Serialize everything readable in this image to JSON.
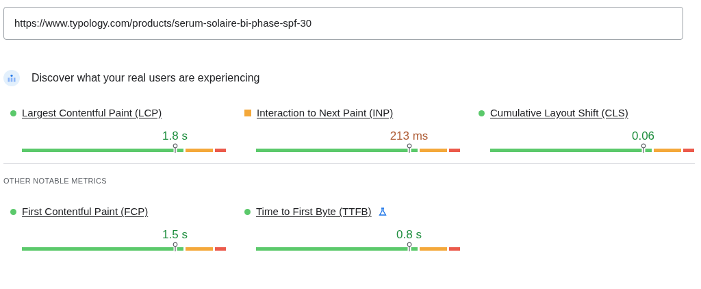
{
  "url_field": {
    "value": "https://www.typology.com/products/serum-solaire-bi-phase-spf-30"
  },
  "field_data": {
    "heading": "Discover what your real users are experiencing",
    "core_metrics": [
      {
        "label": "Largest Contentful Paint (LCP)",
        "kind": "good",
        "value": "1.8 s",
        "experimental": false
      },
      {
        "label": "Interaction to Next Paint (INP)",
        "kind": "average",
        "value": "213 ms",
        "experimental": false
      },
      {
        "label": "Cumulative Layout Shift (CLS)",
        "kind": "good",
        "value": "0.06",
        "experimental": false
      }
    ],
    "other_heading": "OTHER NOTABLE METRICS",
    "other_metrics": [
      {
        "label": "First Contentful Paint (FCP)",
        "kind": "good",
        "value": "1.5 s",
        "experimental": false
      },
      {
        "label": "Time to First Byte (TTFB)",
        "kind": "good",
        "value": "0.8 s",
        "experimental": true
      }
    ]
  }
}
